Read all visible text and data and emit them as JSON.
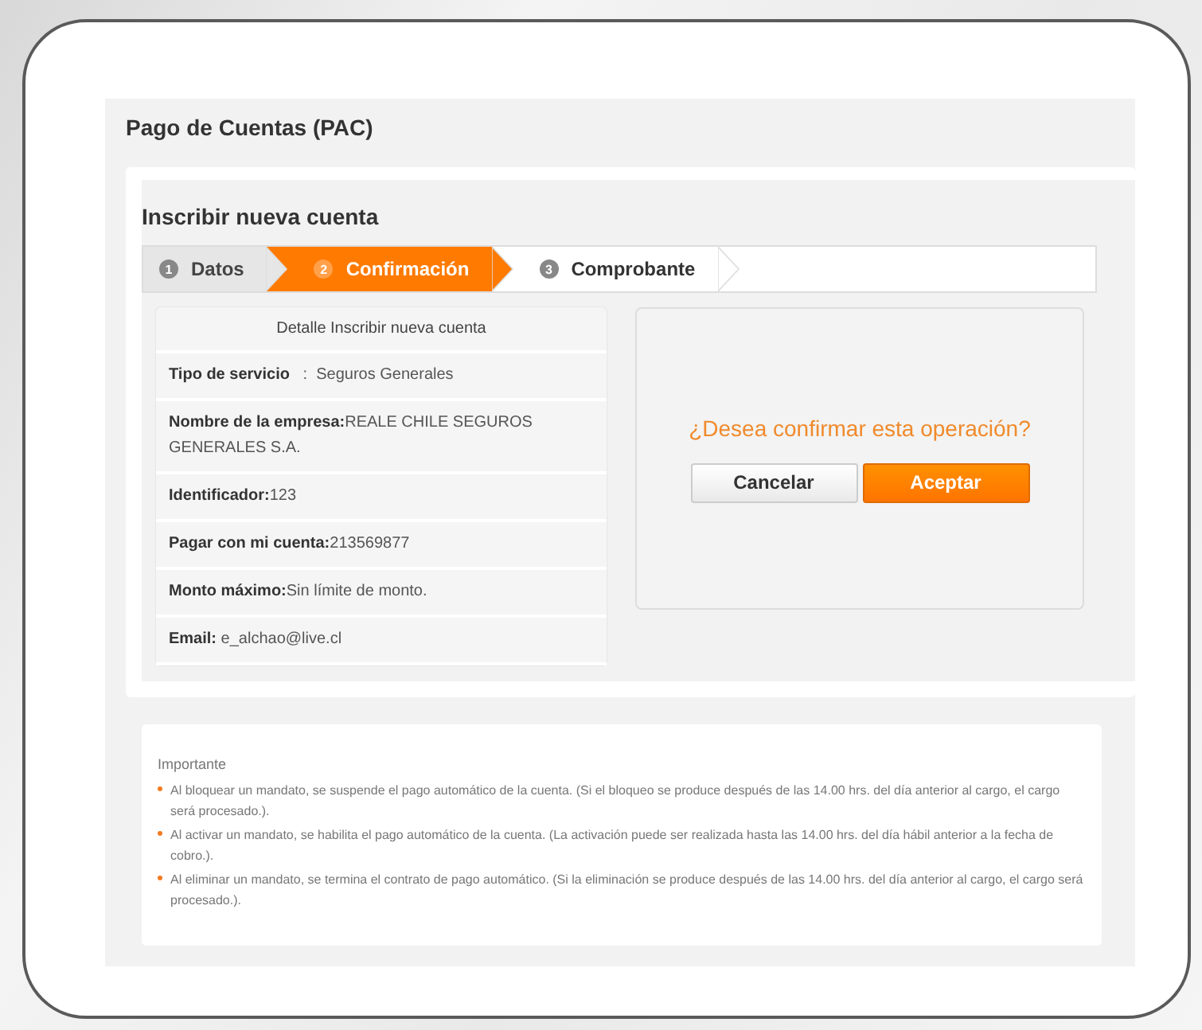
{
  "page_title": "Pago de Cuentas (PAC)",
  "section_title": "Inscribir nueva cuenta",
  "steps": [
    {
      "number": "1",
      "label": "Datos",
      "done": true,
      "selected": false
    },
    {
      "number": "2",
      "label": "Confirmación",
      "done": false,
      "selected": true
    },
    {
      "number": "3",
      "label": "Comprobante",
      "done": false,
      "selected": false
    }
  ],
  "detail": {
    "heading": "Detalle Inscribir nueva cuenta",
    "rows": [
      "**Tipo de servicio**   :  Seguros Generales",
      "**Nombre de la empresa:**REALE CHILE SEGUROS GENERALES S.A.",
      "**Identificador:**123",
      "**Pagar con mi cuenta:**213569877",
      "**Monto máximo:**Sin límite de monto.",
      "**Email:** e_alchao@live.cl"
    ]
  },
  "confirm": {
    "question": "¿Desea confirmar esta operación?",
    "buttons": [
      {
        "label": "Cancelar",
        "kind": "secondary"
      },
      {
        "label": "Aceptar",
        "kind": "primary"
      }
    ]
  },
  "notice": {
    "title": "Importante",
    "items": [
      "Al bloquear un mandato, se suspende el pago automático de la cuenta. (Si el bloqueo se produce después de las 14.00 hrs. del día anterior al cargo, el cargo será procesado.).",
      "Al activar un mandato, se habilita el pago automático de la cuenta. (La activación puede ser realizada hasta las 14.00 hrs. del día hábil anterior a la fecha de cobro.).",
      "Al eliminar un mandato, se termina el contrato de pago automático. (Si la eliminación se produce después de las 14.00 hrs. del día anterior al cargo, el cargo será procesado.)."
    ]
  }
}
